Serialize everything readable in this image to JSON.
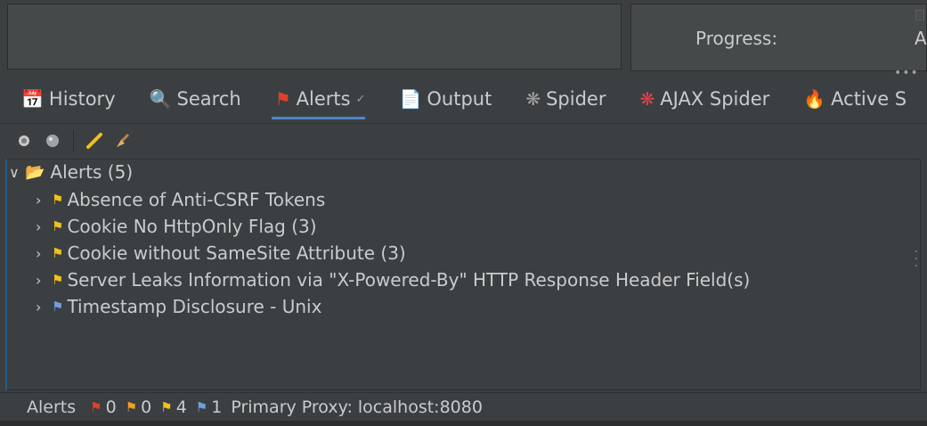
{
  "top_panel": {
    "progress_label": "Progress:",
    "progress_trunc": "A"
  },
  "tabs": [
    {
      "label": "History",
      "icon": "calendar-icon",
      "active": false
    },
    {
      "label": "Search",
      "icon": "magnifier-icon",
      "active": false
    },
    {
      "label": "Alerts",
      "icon": "flag-icon",
      "active": true
    },
    {
      "label": "Output",
      "icon": "document-icon",
      "active": false
    },
    {
      "label": "Spider",
      "icon": "spider-icon",
      "active": false
    },
    {
      "label": "AJAX Spider",
      "icon": "ajax-spider-icon",
      "active": false
    },
    {
      "label": "Active S",
      "icon": "flame-icon",
      "active": false
    }
  ],
  "toolbar": {
    "icons": [
      "record-icon",
      "globe-icon",
      "pencil-icon",
      "broom-icon"
    ]
  },
  "tree": {
    "root": "Alerts (5)",
    "items": [
      {
        "label": "Absence of Anti-CSRF Tokens",
        "flag": "yellow"
      },
      {
        "label": "Cookie No HttpOnly Flag (3)",
        "flag": "yellow"
      },
      {
        "label": "Cookie without SameSite Attribute (3)",
        "flag": "yellow"
      },
      {
        "label": "Server Leaks Information via \"X-Powered-By\" HTTP Response Header Field(s)",
        "flag": "yellow"
      },
      {
        "label": "Timestamp Disclosure - Unix",
        "flag": "blue"
      }
    ]
  },
  "status": {
    "label": "Alerts",
    "high": "0",
    "medium": "0",
    "low": "4",
    "info": "1",
    "proxy": "Primary Proxy: localhost:8080"
  },
  "colors": {
    "background": "#3c3f41",
    "accent": "#4a88c7",
    "flag_high": "#e0402a",
    "flag_medium": "#f0a020",
    "flag_low": "#f0c020",
    "flag_info": "#6fa0e0"
  }
}
